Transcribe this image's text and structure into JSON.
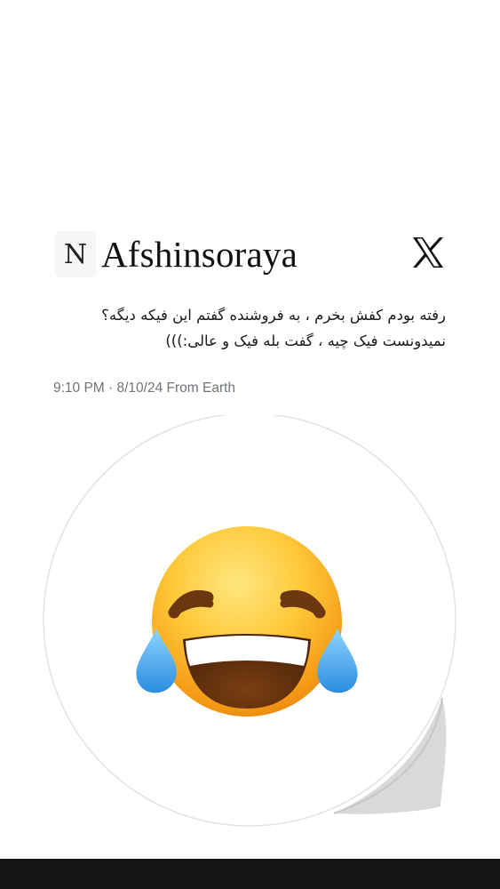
{
  "post": {
    "avatar_letter": "N",
    "username": "Afshinsoraya",
    "logo_icon": "x-logo-icon",
    "text_line1": "رفته بودم کفش بخرم ، به فروشنده گفتم این فیکه دیگه؟",
    "text_line2": "نمیدونست فیک چیه ، گفت بله فیک و عالی:)))",
    "meta": "9:10 PM · 8/10/24 From Earth"
  },
  "sticker": {
    "icon": "face-with-tears-of-joy-icon"
  },
  "colors": {
    "background": "#ffffff",
    "meta_text": "#6e7479",
    "bottom_bar": "#141414"
  }
}
